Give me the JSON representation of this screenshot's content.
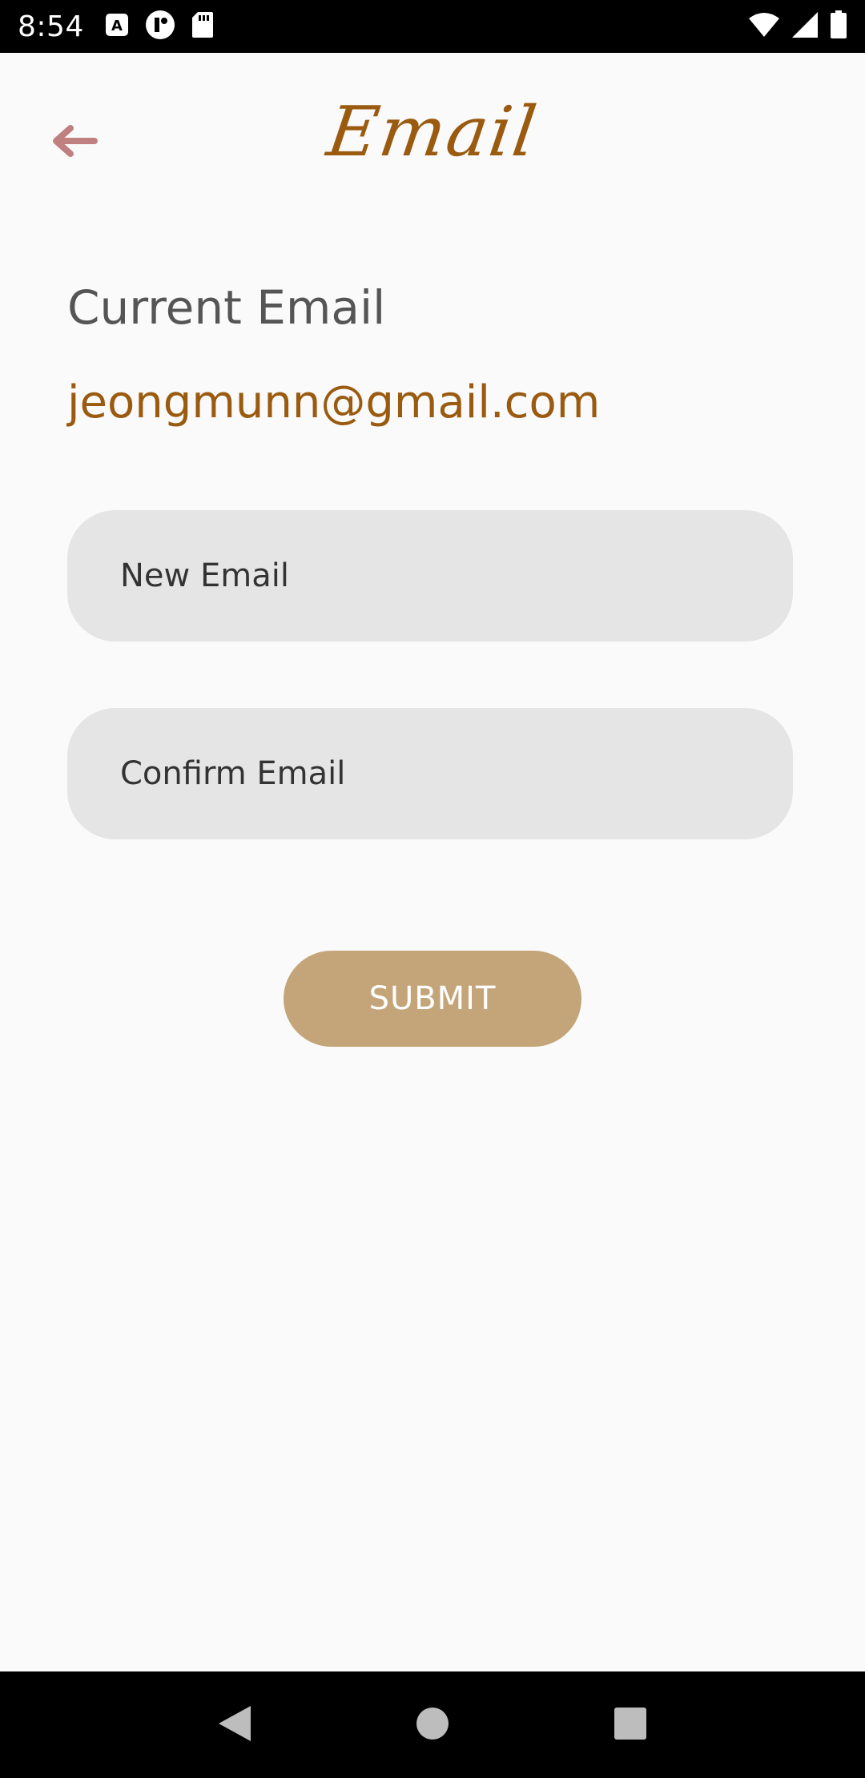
{
  "status_bar": {
    "time": "8:54",
    "left_icons": [
      "a-keyboard-icon",
      "app-notification-icon",
      "sd-card-icon"
    ],
    "right_icons": [
      "wifi-icon",
      "cellular-signal-icon",
      "battery-icon"
    ]
  },
  "app_bar": {
    "title": "Email",
    "back_icon": "arrow-left-icon",
    "accent_color": "#9a5b10",
    "back_color": "#c08080"
  },
  "current_email": {
    "label": "Current Email",
    "value": "jeongmunn@gmail.com"
  },
  "form": {
    "new_email": {
      "placeholder": "New Email",
      "value": ""
    },
    "confirm_email": {
      "placeholder": "Confirm Email",
      "value": ""
    },
    "submit_label": "SUBMIT",
    "submit_color": "#c4a579"
  },
  "nav_bar": {
    "buttons": [
      "back-triangle-icon",
      "home-circle-icon",
      "recents-square-icon"
    ]
  }
}
